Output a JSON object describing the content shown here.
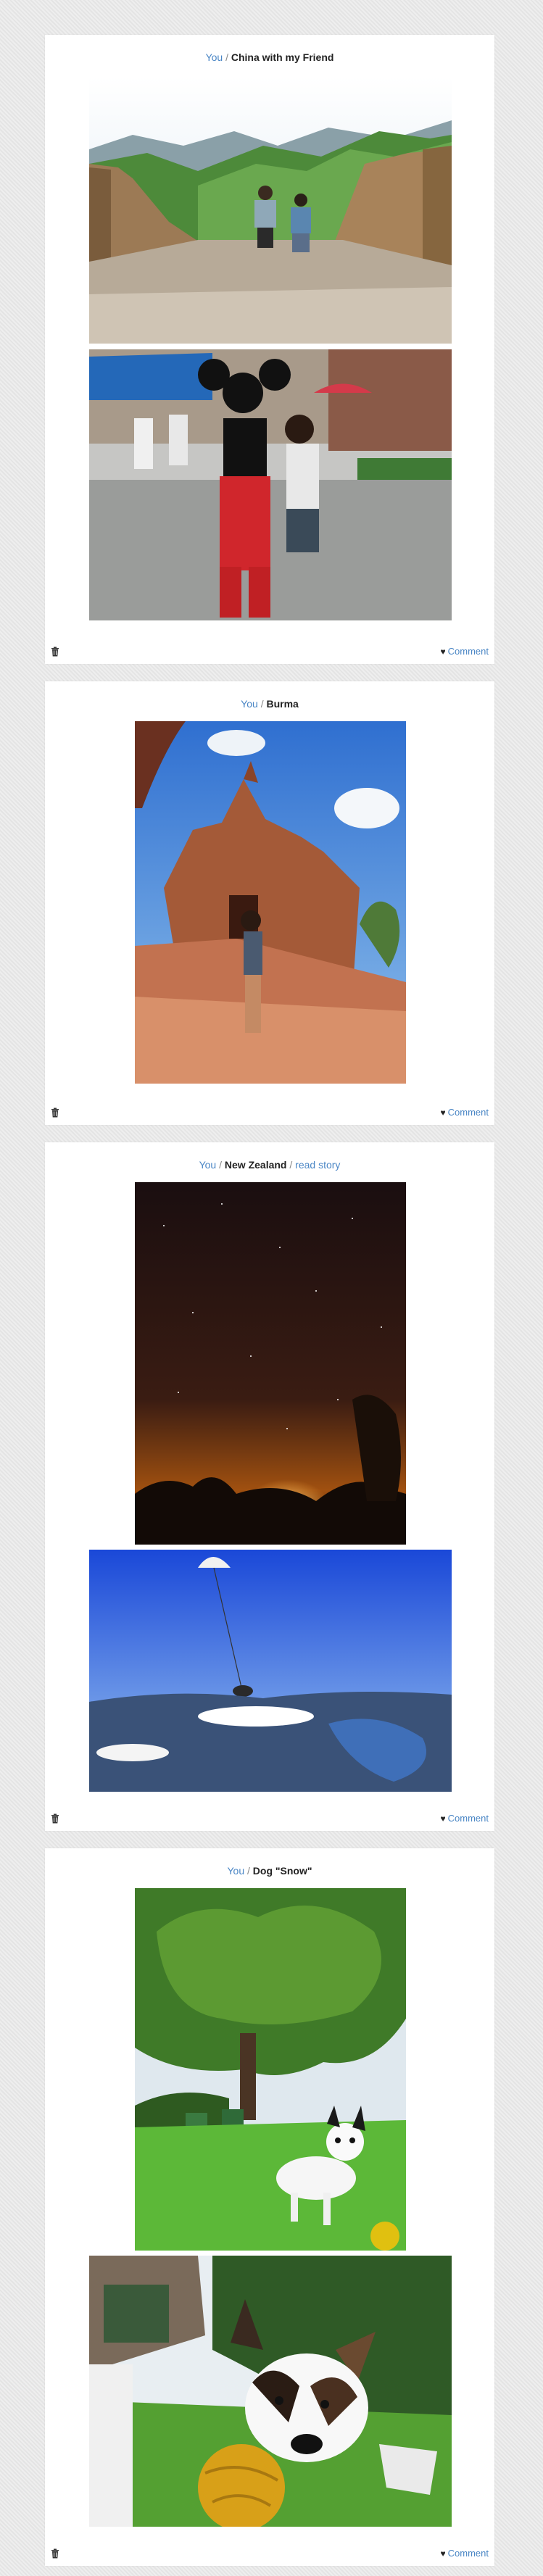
{
  "posts": [
    {
      "owner_link": "You",
      "separator": "/",
      "title": "China with my Friend",
      "photos": [
        {
          "subject": "great-wall-photo"
        },
        {
          "subject": "mickey-mouse-photo"
        }
      ],
      "comment_label": "Comment",
      "trash_icon": "trash-icon",
      "heart_icon": "heart-icon"
    },
    {
      "owner_link": "You",
      "separator": "/",
      "title": "Burma",
      "photos": [
        {
          "subject": "burma-temple-photo"
        }
      ],
      "comment_label": "Comment"
    },
    {
      "owner_link": "You",
      "separator": "/",
      "title": "New Zealand",
      "extra_separator": "/",
      "extra_link": "read story",
      "photos": [
        {
          "subject": "night-sky-photo"
        },
        {
          "subject": "skydiving-photo"
        }
      ],
      "comment_label": "Comment"
    },
    {
      "owner_link": "You",
      "separator": "/",
      "title": "Dog \"Snow\"",
      "photos": [
        {
          "subject": "dog-on-lawn-photo"
        },
        {
          "subject": "dog-closeup-photo"
        }
      ],
      "comment_label": "Comment"
    }
  ],
  "colors": {
    "link": "#4a86c5",
    "background": "#e8e8e8",
    "card": "#ffffff"
  }
}
